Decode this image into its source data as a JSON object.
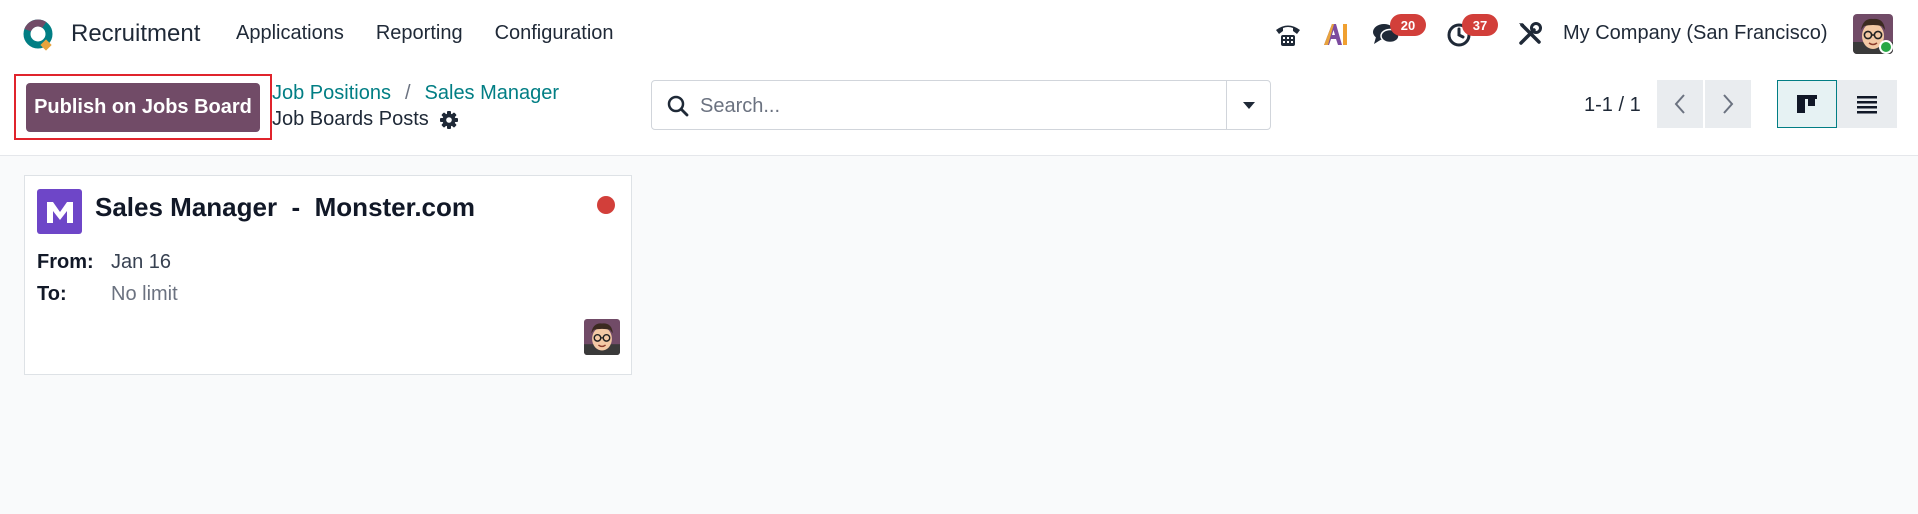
{
  "app": {
    "name": "Recruitment"
  },
  "nav": {
    "items": [
      "Applications",
      "Reporting",
      "Configuration"
    ]
  },
  "systray": {
    "messages_count": "20",
    "activities_count": "37",
    "company": "My Company (San Francisco)"
  },
  "control": {
    "publish_label": "Publish on Jobs Board",
    "breadcrumb": [
      "Job Positions",
      "Sales Manager"
    ],
    "breadcrumb_sep": "/",
    "title": "Job Boards Posts",
    "search_placeholder": "Search...",
    "pager": "1-1 / 1"
  },
  "card": {
    "title": "Sales Manager  -  Monster.com",
    "from_label": "From:",
    "from_value": "Jan 16",
    "to_label": "To:",
    "to_value": "No limit"
  },
  "colors": {
    "primary": "#714b67",
    "link": "#017e84",
    "badge": "#d23f3a",
    "highlight": "#e0242c",
    "monster": "#6e46c8"
  }
}
